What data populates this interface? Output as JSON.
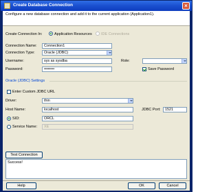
{
  "window": {
    "title": "Create Database Connection",
    "banner": "Configure a new database connection and add it to the current application (Application1)."
  },
  "create_in": {
    "label": "Create Connection In:",
    "option_app": "Application Resources",
    "option_ide": "IDE Connections"
  },
  "fields": {
    "connection_name_label": "Connection Name:",
    "connection_name": "Connection1",
    "connection_type_label": "Connection Type:",
    "connection_type": "Oracle (JDBC)",
    "username_label": "Username:",
    "username": "sys as sysdba",
    "role_label": "Role:",
    "role": "",
    "password_label": "Password:",
    "password": "••••••••",
    "save_password_label": "Save Password"
  },
  "oracle_settings": {
    "section_title": "Oracle (JDBC) Settings",
    "custom_url_label": "Enter Custom JDBC URL",
    "driver_label": "Driver:",
    "driver": "thin",
    "host_label": "Host Name:",
    "host": "localhost",
    "port_label": "JDBC Port:",
    "port": "1521",
    "sid_label": "SID:",
    "sid": "ORCL",
    "service_label": "Service Name:",
    "service": "XE"
  },
  "actions": {
    "test_label": "Test Connection",
    "status": "Success!",
    "help": "Help",
    "ok": "OK",
    "cancel": "Cancel"
  }
}
